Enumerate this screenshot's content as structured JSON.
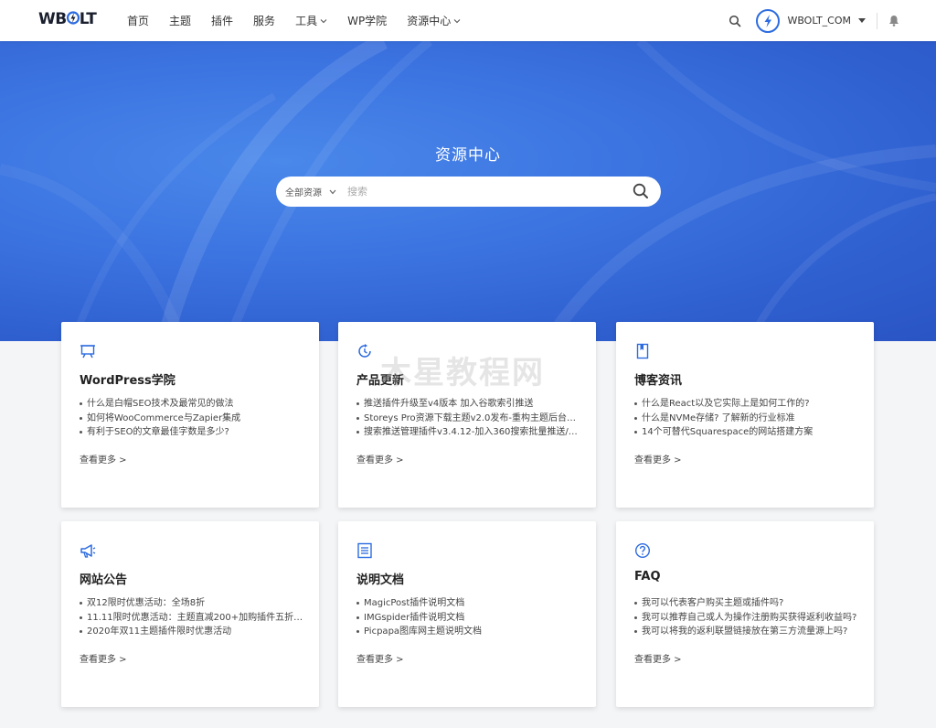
{
  "header": {
    "logo": {
      "left": "WB",
      "bolt": "O",
      "right": "LT"
    },
    "nav": [
      {
        "label": "首页",
        "dropdown": false
      },
      {
        "label": "主题",
        "dropdown": false
      },
      {
        "label": "插件",
        "dropdown": false
      },
      {
        "label": "服务",
        "dropdown": false
      },
      {
        "label": "工具",
        "dropdown": true
      },
      {
        "label": "WP学院",
        "dropdown": false
      },
      {
        "label": "资源中心",
        "dropdown": true
      }
    ],
    "username": "WBOLT_COM"
  },
  "hero": {
    "title": "资源中心",
    "scope": "全部资源",
    "search_placeholder": "搜索"
  },
  "cards": [
    {
      "title": "WordPress学院",
      "icon": "presentation-icon",
      "items": [
        "什么是白帽SEO技术及最常见的做法",
        "如何将WooCommerce与Zapier集成",
        "有利于SEO的文章最佳字数是多少?"
      ],
      "more": "查看更多 >"
    },
    {
      "title": "产品更新",
      "icon": "update-icon",
      "items": [
        "推送插件升级至v4版本 加入谷歌索引推送",
        "Storeys Pro资源下载主题v2.0发布-重构主题后台结…",
        "搜索推送管理插件v3.4.12-加入360搜索批量推送/插…"
      ],
      "more": "查看更多 >"
    },
    {
      "title": "博客资讯",
      "icon": "bookmark-icon",
      "items": [
        "什么是React以及它实际上是如何工作的?",
        "什么是NVMe存储? 了解新的行业标准",
        "14个可替代Squarespace的网站搭建方案"
      ],
      "more": "查看更多 >"
    },
    {
      "title": "网站公告",
      "icon": "megaphone-icon",
      "items": [
        "双12限时优惠活动：全场8折",
        "11.11限时优惠活动：主题直减200+加购插件五折/…",
        "2020年双11主题插件限时优惠活动"
      ],
      "more": "查看更多 >"
    },
    {
      "title": "说明文档",
      "icon": "document-icon",
      "items": [
        "MagicPost插件说明文档",
        "IMGspider插件说明文档",
        "Picpapa图库网主题说明文档"
      ],
      "more": "查看更多 >"
    },
    {
      "title": "FAQ",
      "icon": "question-icon",
      "items": [
        "我可以代表客户购买主题或插件吗?",
        "我可以推荐自己或人为操作注册购买获得返利收益吗?",
        "我可以将我的返利联盟链接放在第三方流量源上吗?"
      ],
      "more": "查看更多 >"
    }
  ],
  "watermark": "木星教程网",
  "colors": {
    "accent": "#2c6be0",
    "hero": "#3b73e0"
  }
}
